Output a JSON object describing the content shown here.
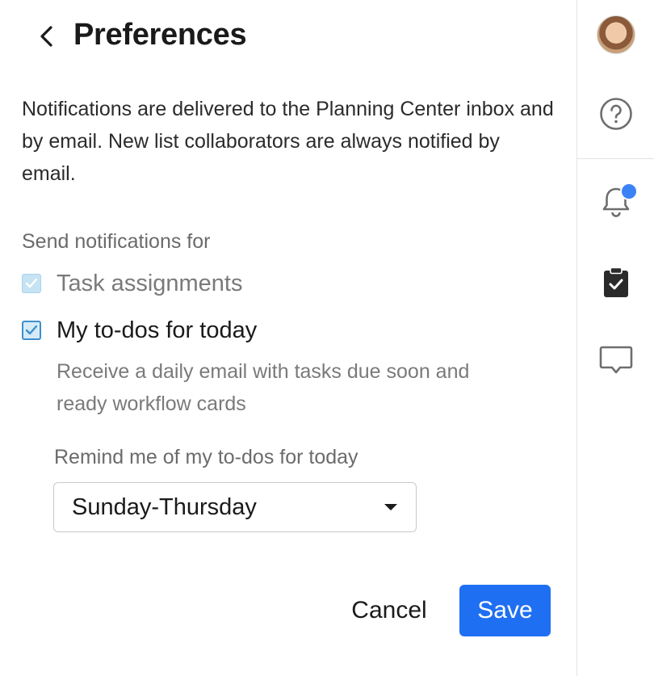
{
  "header": {
    "back_icon": "chevron-left-icon",
    "title": "Preferences"
  },
  "intro_text": "Notifications are delivered to the Planning Center inbox and by email. New list collaborators are always notified by email.",
  "notifications": {
    "section_label": "Send notifications for",
    "options": [
      {
        "label": "Task assignments",
        "checked": true,
        "disabled": true
      },
      {
        "label": "My to-dos for today",
        "checked": true,
        "disabled": false
      }
    ],
    "todos_help": "Receive a daily email with tasks due soon and ready workflow cards"
  },
  "reminder": {
    "label": "Remind me of my to-dos for today",
    "selected": "Sunday-Thursday"
  },
  "actions": {
    "cancel_label": "Cancel",
    "save_label": "Save"
  },
  "rail": {
    "items": [
      "avatar",
      "help-icon",
      "bell-icon",
      "clipboard-check-icon",
      "chat-icon"
    ],
    "notification_badge": true
  },
  "colors": {
    "primary": "#1f6ff2",
    "checkbox_border": "#3f8fcc",
    "badge": "#3b82f6"
  }
}
